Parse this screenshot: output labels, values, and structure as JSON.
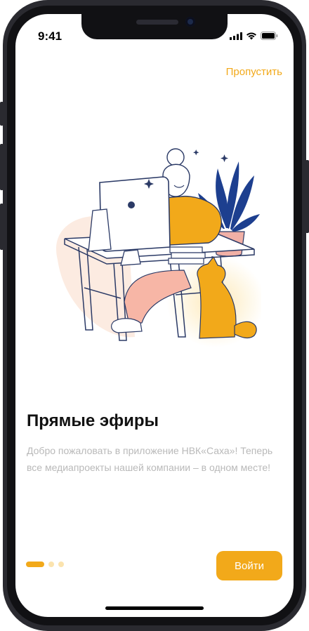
{
  "status_bar": {
    "time": "9:41",
    "icons": [
      "signal-icon",
      "wifi-icon",
      "battery-icon"
    ]
  },
  "onboarding": {
    "skip_label": "Пропустить",
    "title": "Прямые эфиры",
    "description": "Добро пожаловать в приложение НВК«Саха»! Теперь все медиапроекты нашей компании – в одном месте!",
    "pager": {
      "page_count": 3,
      "active_page": 1
    },
    "login_label": "Войти"
  },
  "colors": {
    "accent": "#f2a91a",
    "accent_light": "#fbe3ae",
    "title": "#111111",
    "description": "#b9b9b9",
    "plant": "#1d3f8f",
    "pot": "#f1b0a6"
  }
}
